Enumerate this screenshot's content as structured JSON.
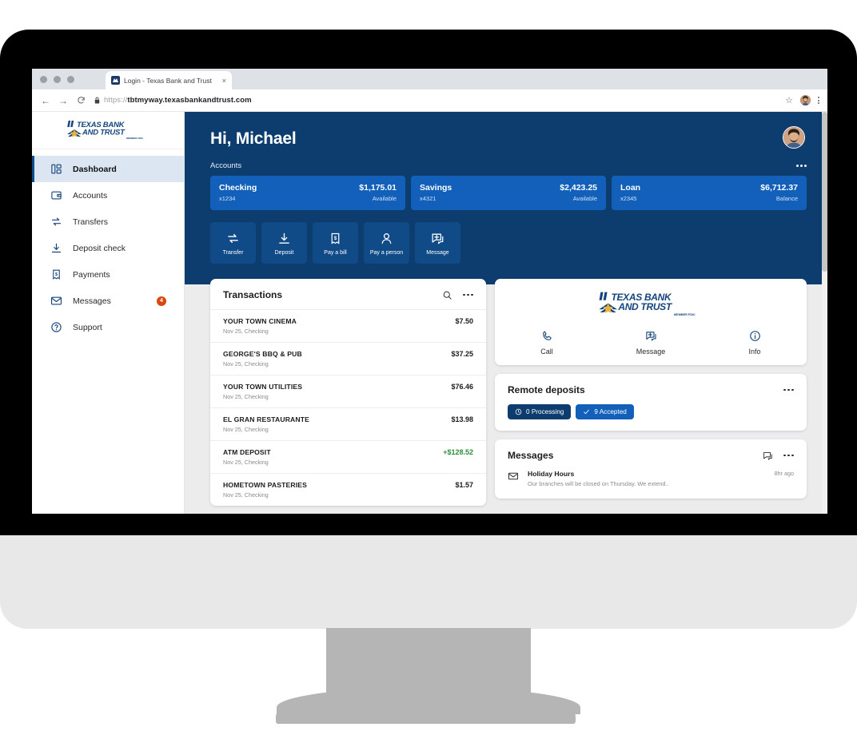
{
  "browser": {
    "tab_title": "Login - Texas Bank and Trust",
    "tab_close": "×",
    "back_icon": "←",
    "forward_icon": "→",
    "reload_icon": "⟳",
    "lock_icon": "🔒",
    "url_scheme": "https://",
    "url_domain": "tbtmyway.texasbankandtrust.com",
    "star_icon": "☆"
  },
  "sidebar": {
    "logo_line1": "TEXAS BANK",
    "logo_line2": "AND TRUST",
    "logo_sub": "MEMBER FDIC",
    "items": [
      {
        "label": "Dashboard",
        "icon": "dashboard-icon",
        "active": true,
        "badge": ""
      },
      {
        "label": "Accounts",
        "icon": "accounts-icon",
        "active": false,
        "badge": ""
      },
      {
        "label": "Transfers",
        "icon": "transfers-icon",
        "active": false,
        "badge": ""
      },
      {
        "label": "Deposit check",
        "icon": "deposit-icon",
        "active": false,
        "badge": ""
      },
      {
        "label": "Payments",
        "icon": "payments-icon",
        "active": false,
        "badge": ""
      },
      {
        "label": "Messages",
        "icon": "messages-icon",
        "active": false,
        "badge": "4"
      },
      {
        "label": "Support",
        "icon": "support-icon",
        "active": false,
        "badge": ""
      }
    ]
  },
  "hero": {
    "greeting": "Hi, Michael",
    "accounts_label": "Accounts",
    "accounts": [
      {
        "name": "Checking",
        "amount": "$1,175.01",
        "number": "x1234",
        "type": "Available"
      },
      {
        "name": "Savings",
        "amount": "$2,423.25",
        "number": "x4321",
        "type": "Available"
      },
      {
        "name": "Loan",
        "amount": "$6,712.37",
        "number": "x2345",
        "type": "Balance"
      }
    ],
    "actions": [
      {
        "label": "Transfer",
        "icon": "transfer-icon"
      },
      {
        "label": "Deposit",
        "icon": "deposit-down-icon"
      },
      {
        "label": "Pay a bill",
        "icon": "bill-icon"
      },
      {
        "label": "Pay a person",
        "icon": "person-icon"
      },
      {
        "label": "Message",
        "icon": "message-plus-icon"
      }
    ]
  },
  "transactions_card": {
    "title": "Transactions",
    "items": [
      {
        "name": "YOUR TOWN CINEMA",
        "meta": "Nov 25, Checking",
        "amount": "$7.50",
        "credit": false
      },
      {
        "name": "GEORGE'S BBQ & PUB",
        "meta": "Nov 25, Checking",
        "amount": "$37.25",
        "credit": false
      },
      {
        "name": "YOUR TOWN UTILITIES",
        "meta": "Nov 25, Checking",
        "amount": "$76.46",
        "credit": false
      },
      {
        "name": "EL GRAN RESTAURANTE",
        "meta": "Nov 25, Checking",
        "amount": "$13.98",
        "credit": false
      },
      {
        "name": "ATM DEPOSIT",
        "meta": "Nov 25, Checking",
        "amount": "+$128.52",
        "credit": true
      },
      {
        "name": "HOMETOWN PASTERIES",
        "meta": "Nov 25, Checking",
        "amount": "$1.57",
        "credit": false
      }
    ]
  },
  "contact_card": {
    "logo_line1": "TEXAS BANK",
    "logo_line2": "AND TRUST",
    "logo_sub": "MEMBER FDIC",
    "items": [
      {
        "label": "Call",
        "icon": "phone-icon"
      },
      {
        "label": "Message",
        "icon": "message-plus-icon"
      },
      {
        "label": "Info",
        "icon": "info-icon"
      }
    ]
  },
  "remote_deposits_card": {
    "title": "Remote deposits",
    "pills": [
      {
        "label": "0 Processing",
        "icon": "clock-icon",
        "style": "dark"
      },
      {
        "label": "9 Accepted",
        "icon": "check-icon",
        "style": "bright"
      }
    ]
  },
  "messages_card": {
    "title": "Messages",
    "items": [
      {
        "title": "Holiday Hours",
        "preview": "Our branches will be closed on Thursday. We extend..",
        "time": "8hr ago"
      }
    ]
  },
  "colors": {
    "hero_navy": "#0d3c6e",
    "card_blue": "#1260ba",
    "action_blue": "#104a87",
    "brand_navy": "#15447c",
    "badge_orange": "#d9480f",
    "credit_green": "#2e8b3d",
    "page_bg": "#ececed"
  }
}
